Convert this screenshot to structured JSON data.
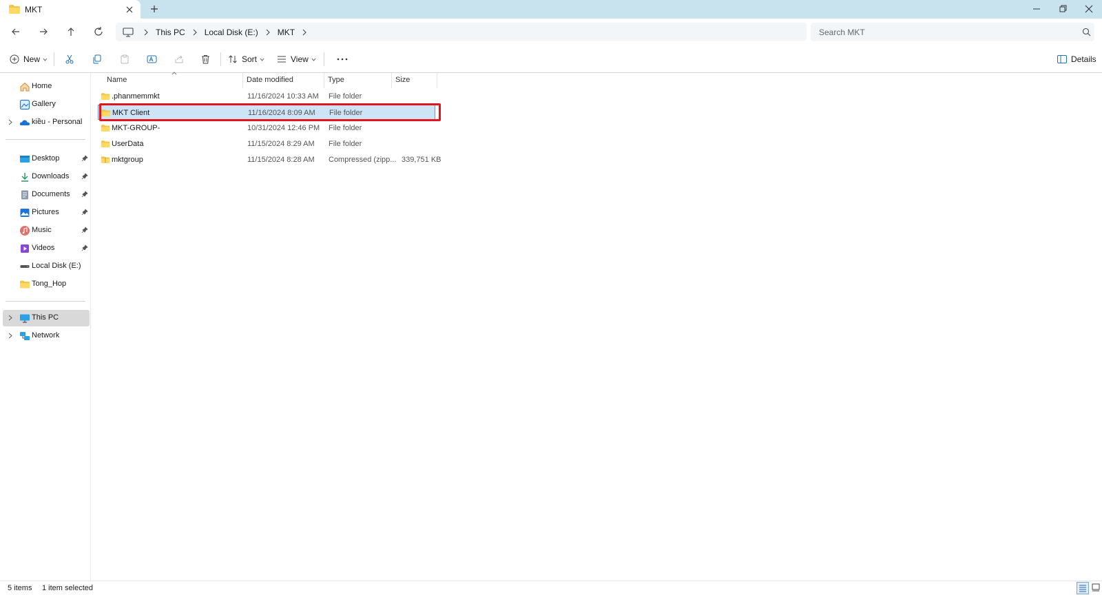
{
  "window": {
    "tab_title": "MKT"
  },
  "address": {
    "crumbs": [
      "This PC",
      "Local Disk (E:)",
      "MKT"
    ],
    "search_placeholder": "Search MKT"
  },
  "toolbar": {
    "new_label": "New",
    "sort_label": "Sort",
    "view_label": "View",
    "details_label": "Details"
  },
  "sidebar": {
    "items": [
      {
        "label": "Home",
        "icon": "home-icon"
      },
      {
        "label": "Gallery",
        "icon": "gallery-icon"
      },
      {
        "label": "kiều - Personal",
        "icon": "onedrive-icon"
      },
      {
        "label": "Desktop",
        "icon": "desktop-icon"
      },
      {
        "label": "Downloads",
        "icon": "downloads-icon"
      },
      {
        "label": "Documents",
        "icon": "documents-icon"
      },
      {
        "label": "Pictures",
        "icon": "pictures-icon"
      },
      {
        "label": "Music",
        "icon": "music-icon"
      },
      {
        "label": "Videos",
        "icon": "videos-icon"
      },
      {
        "label": "Local Disk (E:)",
        "icon": "drive-icon"
      },
      {
        "label": "Tong_Hop",
        "icon": "folder-icon"
      },
      {
        "label": "This PC",
        "icon": "computer-icon"
      },
      {
        "label": "Network",
        "icon": "network-icon"
      }
    ]
  },
  "columns": {
    "name": "Name",
    "date": "Date modified",
    "type": "Type",
    "size": "Size"
  },
  "files": [
    {
      "name": ".phanmemmkt",
      "date": "11/16/2024 10:33 AM",
      "type": "File folder",
      "size": ""
    },
    {
      "name": "MKT Client",
      "date": "11/16/2024 8:09 AM",
      "type": "File folder",
      "size": ""
    },
    {
      "name": "MKT-GROUP-",
      "date": "10/31/2024 12:46 PM",
      "type": "File folder",
      "size": ""
    },
    {
      "name": "UserData",
      "date": "11/15/2024 8:29 AM",
      "type": "File folder",
      "size": ""
    },
    {
      "name": "mktgroup",
      "date": "11/15/2024 8:28 AM",
      "type": "Compressed (zipp...",
      "size": "339,751 KB"
    }
  ],
  "status": {
    "items_count": "5 items",
    "selection": "1 item selected"
  },
  "colors": {
    "titlebar": "#c9e3ee",
    "selection": "#cce4f6",
    "highlight": "#e3141b",
    "folder": "#f4c542"
  }
}
